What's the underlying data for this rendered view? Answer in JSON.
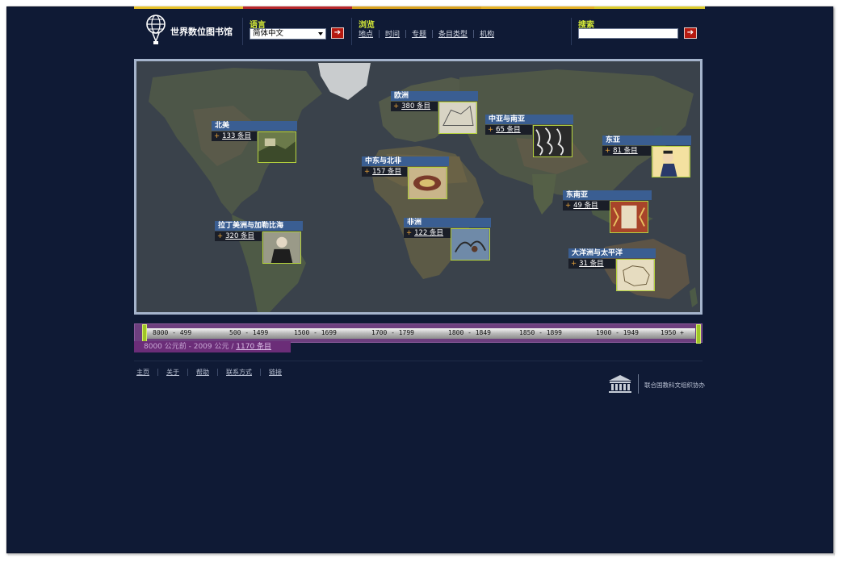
{
  "header": {
    "site_title": "世界数位图书馆",
    "language": {
      "label": "语言",
      "selected": "简体中文"
    },
    "browse": {
      "label": "浏览",
      "links": [
        "地点",
        "时间",
        "专题",
        "条目类型",
        "机构"
      ]
    },
    "search": {
      "label": "搜索",
      "value": ""
    },
    "go_glyph": "➔"
  },
  "map": {
    "regions": [
      {
        "name": "北美",
        "count": "133 条目"
      },
      {
        "name": "欧洲",
        "count": "380 条目"
      },
      {
        "name": "中亚与南亚",
        "count": "65 条目"
      },
      {
        "name": "东亚",
        "count": "81 条目"
      },
      {
        "name": "中东与北非",
        "count": "157 条目"
      },
      {
        "name": "东南亚",
        "count": "49 条目"
      },
      {
        "name": "拉丁美洲与加勒比海",
        "count": "320 条目"
      },
      {
        "name": "非洲",
        "count": "122 条目"
      },
      {
        "name": "大洋洲与太平洋",
        "count": "31 条目"
      }
    ],
    "plus_glyph": "+"
  },
  "timeline": {
    "periods": [
      "8000 - 499",
      "500 - 1499",
      "1500 - 1699",
      "1700 - 1799",
      "1800 - 1849",
      "1850 - 1899",
      "1900 - 1949",
      "1950 +"
    ],
    "summary_range": "8000 公元前 - 2009 公元 / ",
    "summary_count": "1170 条目"
  },
  "footer": {
    "links": [
      "主页",
      "关于",
      "帮助",
      "联系方式",
      "链接"
    ],
    "partner": "联合国教科文组织协办"
  },
  "colors": {
    "background": "#0f1a35",
    "accent_green": "#d7eb37",
    "region_title": "#3a5e92",
    "timeline_purple": "#6d3f7f",
    "go_button": "#b51a10"
  }
}
